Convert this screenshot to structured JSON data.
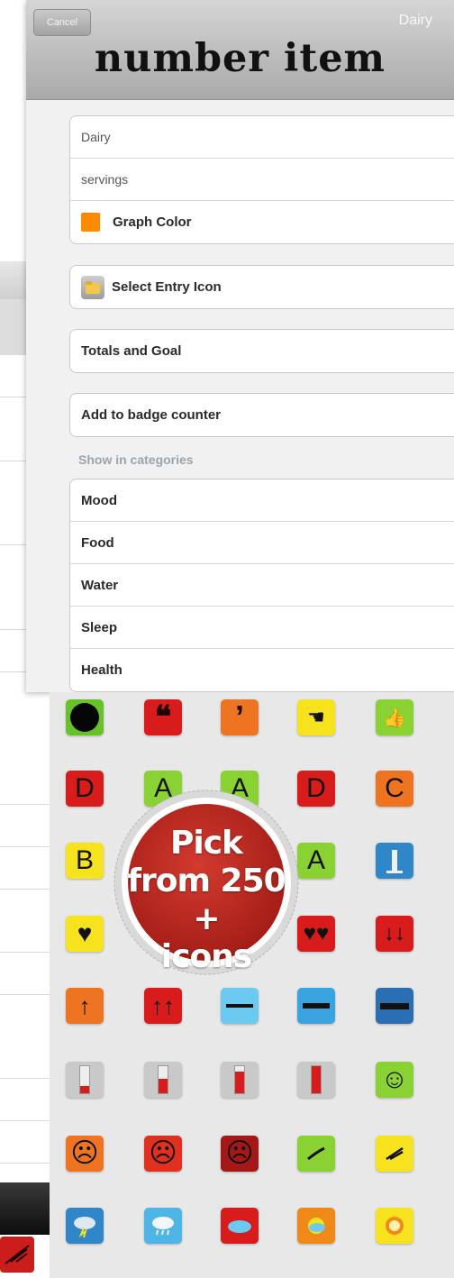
{
  "nav": {
    "cancel_label": "Cancel",
    "title": "Dairy"
  },
  "overlay_caption": "number item",
  "form": {
    "name_value": "Dairy",
    "unit_value": "servings",
    "graph_color_label": "Graph Color",
    "graph_color": "#ff8a00",
    "select_icon_label": "Select Entry Icon",
    "totals_goal_label": "Totals and Goal",
    "badge_counter_label": "Add to badge counter",
    "categories_header": "Show in categories",
    "categories": [
      "Mood",
      "Food",
      "Water",
      "Sleep",
      "Health"
    ]
  },
  "badge": {
    "line1": "Pick",
    "line2": "from 250 +",
    "line3": "icons"
  },
  "icons": {
    "row1": [
      "black-circle-icon",
      "quote-open-icon",
      "quote-close-icon",
      "pointing-hand-icon",
      "thumbs-up-icon"
    ],
    "row2_letters": [
      "D",
      "A",
      "A",
      "D",
      "C"
    ],
    "row3_letters": [
      "B",
      "",
      "",
      "A",
      ""
    ],
    "row4": [
      "broken-heart-icon",
      "",
      "",
      "hearts-icon",
      "double-down-arrow-icon"
    ],
    "row5": [
      "up-arrow-icon",
      "double-up-arrow-icon",
      "minus-light-icon",
      "minus-mid-icon",
      "minus-dark-icon"
    ],
    "row6": [
      "thermometer-low-icon",
      "thermometer-mid-icon",
      "thermometer-high-icon",
      "thermometer-full-icon",
      "smile-face-icon"
    ],
    "row7": [
      "sad-face-icon",
      "sad-face-icon",
      "frown-face-icon",
      "lime-stroke-icon",
      "yellow-stroke-icon"
    ],
    "row8": [
      "storm-cloud-icon",
      "rain-cloud-icon",
      "cloud-icon",
      "sun-cloud-icon",
      "sun-icon"
    ]
  }
}
